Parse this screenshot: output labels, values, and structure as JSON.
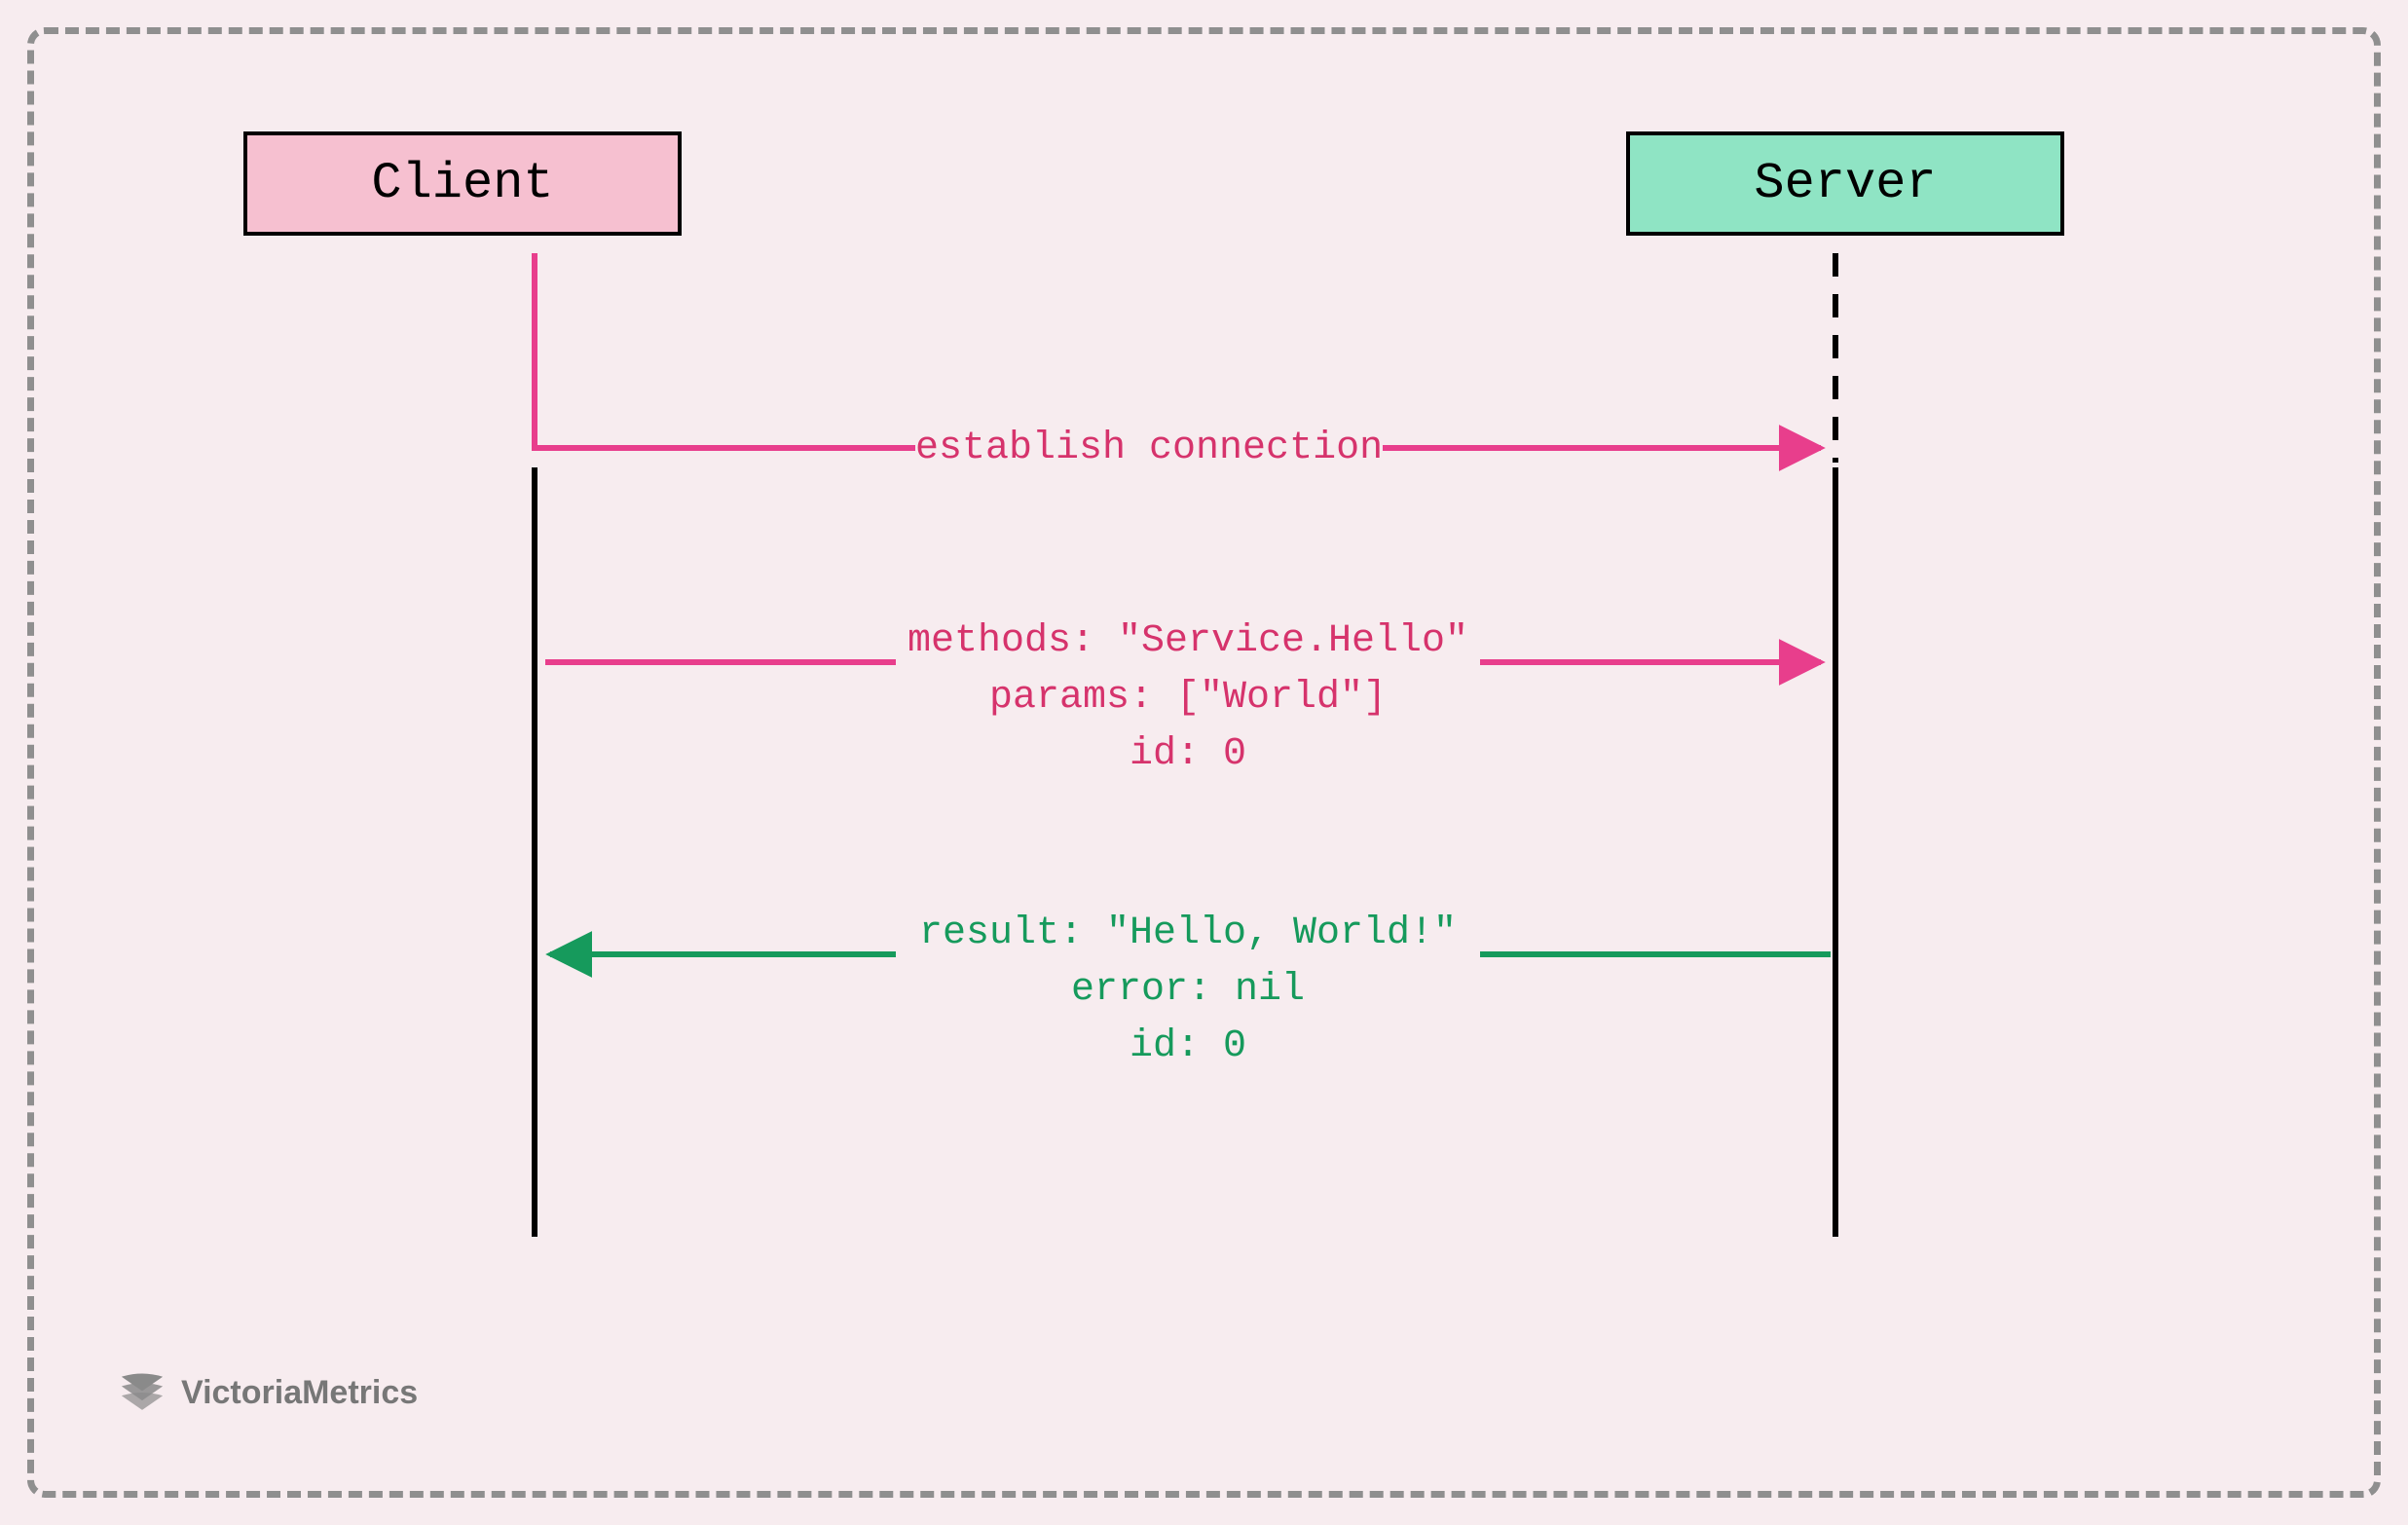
{
  "participants": {
    "client": "Client",
    "server": "Server"
  },
  "messages": {
    "establish": {
      "label": "establish connection",
      "color": "#e83e8c"
    },
    "request": {
      "lines": [
        "methods: \"Service.Hello\"",
        "params: [\"World\"]",
        "id: 0"
      ],
      "color": "#e83e8c"
    },
    "response": {
      "lines": [
        "result: \"Hello, World!\"",
        "error: nil",
        "id: 0"
      ],
      "color": "#169a5c"
    }
  },
  "attribution": "VictoriaMetrics"
}
